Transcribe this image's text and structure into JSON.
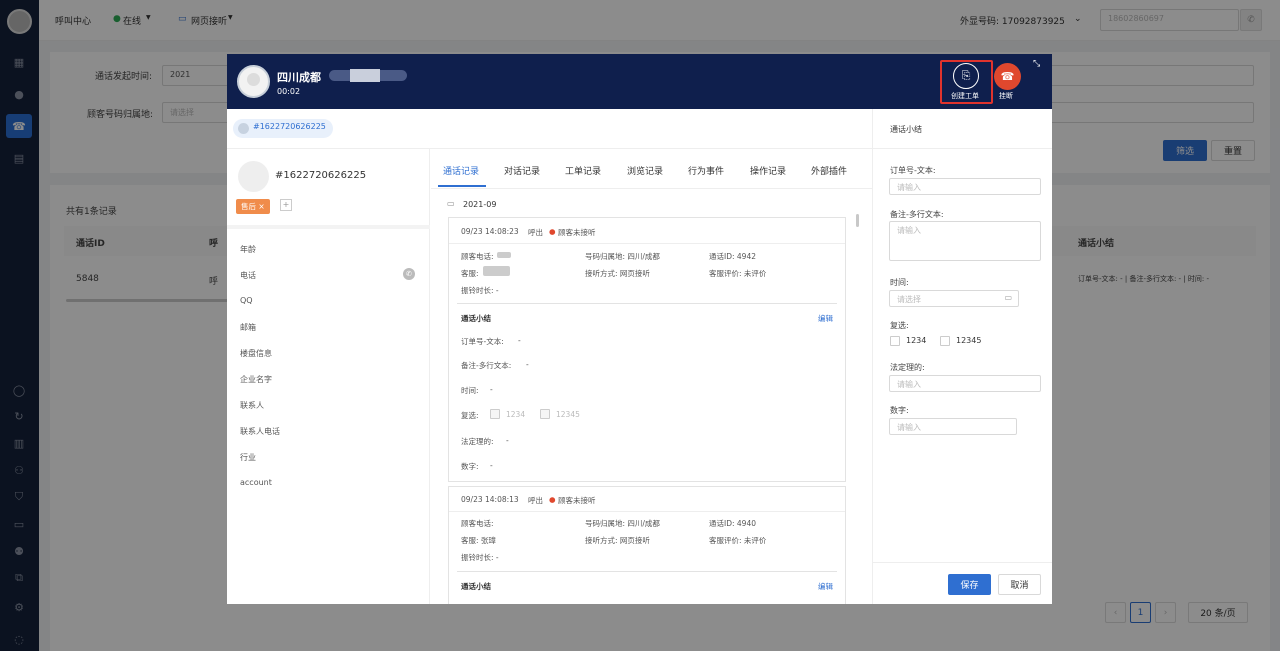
{
  "topbar": {
    "title": "呼叫中心",
    "status": "在线",
    "mode": "网页接听",
    "outbound_label": "外显号码: 17092873925",
    "phone_input": "18602860697"
  },
  "filters": {
    "call_time_label": "通话发起时间:",
    "call_time_value": "2021",
    "origin_label": "顾客号码归属地:",
    "origin_placeholder": "请选择",
    "filter_btn": "筛选",
    "reset_btn": "重置"
  },
  "table": {
    "total": "共有1条记录",
    "headers": [
      "通话ID",
      "呼",
      "通话小结"
    ],
    "row": {
      "id": "5848",
      "type": "呼",
      "summary": "订单号-文本: - | 备注-多行文本: - | 时间: -"
    }
  },
  "pagination": {
    "page": "1",
    "page_size": "20 条/页"
  },
  "modal": {
    "caller_name": "四川成都",
    "timer": "00:02",
    "create_ticket": "创建工单",
    "hangup": "挂断",
    "customer_chip": "#1622720626225",
    "customer_id": "#1622720626225",
    "tag": "售后 ×",
    "fields": [
      "年龄",
      "电话",
      "QQ",
      "邮箱",
      "楼盘信息",
      "企业名字",
      "联系人",
      "联系人电话",
      "行业",
      "account"
    ],
    "tabs": [
      "通话记录",
      "对话记录",
      "工单记录",
      "浏览记录",
      "行为事件",
      "操作记录",
      "外部插件"
    ],
    "month": "2021-09",
    "records": [
      {
        "time": "09/23 14:08:23",
        "direction": "呼出",
        "status": "顾客未接听",
        "customer_phone": "顾客电话:",
        "origin": "号码归属地: 四川/成都",
        "call_id": "通话ID: 4942",
        "agent": "客服:",
        "answer_mode": "接听方式: 网页接听",
        "rating": "客服评价: 未评价",
        "ring": "振铃时长: -",
        "summary_title": "通话小结",
        "edit": "编辑",
        "order": "订单号-文本:",
        "order_val": "-",
        "note": "备注-多行文本:",
        "note_val": "-",
        "time_lbl": "时间:",
        "time_val": "-",
        "check_lbl": "复选:",
        "opt1": "1234",
        "opt2": "12345",
        "legal": "法定理的:",
        "legal_val": "-",
        "number": "数字:",
        "number_val": "-"
      },
      {
        "time": "09/23 14:08:13",
        "direction": "呼出",
        "status": "顾客未接听",
        "customer_phone": "顾客电话:",
        "origin": "号码归属地: 四川/成都",
        "call_id": "通话ID: 4940",
        "agent": "客服: 张璋",
        "answer_mode": "接听方式: 网页接听",
        "rating": "客服评价: 未评价",
        "ring": "振铃时长: -",
        "summary_title": "通话小结",
        "edit": "编辑"
      }
    ],
    "summary_panel": {
      "title": "通话小结",
      "order_label": "订单号-文本:",
      "order_placeholder": "请输入",
      "note_label": "备注-多行文本:",
      "note_placeholder": "请输入",
      "time_label": "时间:",
      "time_placeholder": "请选择",
      "check_label": "复选:",
      "opt1": "1234",
      "opt2": "12345",
      "legal_label": "法定理的:",
      "legal_placeholder": "请输入",
      "number_label": "数字:",
      "number_placeholder": "请输入",
      "save": "保存",
      "cancel": "取消"
    }
  },
  "colors": {
    "sidebar": "#15223b",
    "header": "#0f1f4d",
    "accent": "#2f6fd1",
    "hangup": "#e0482e",
    "tag": "#f08c4b"
  }
}
